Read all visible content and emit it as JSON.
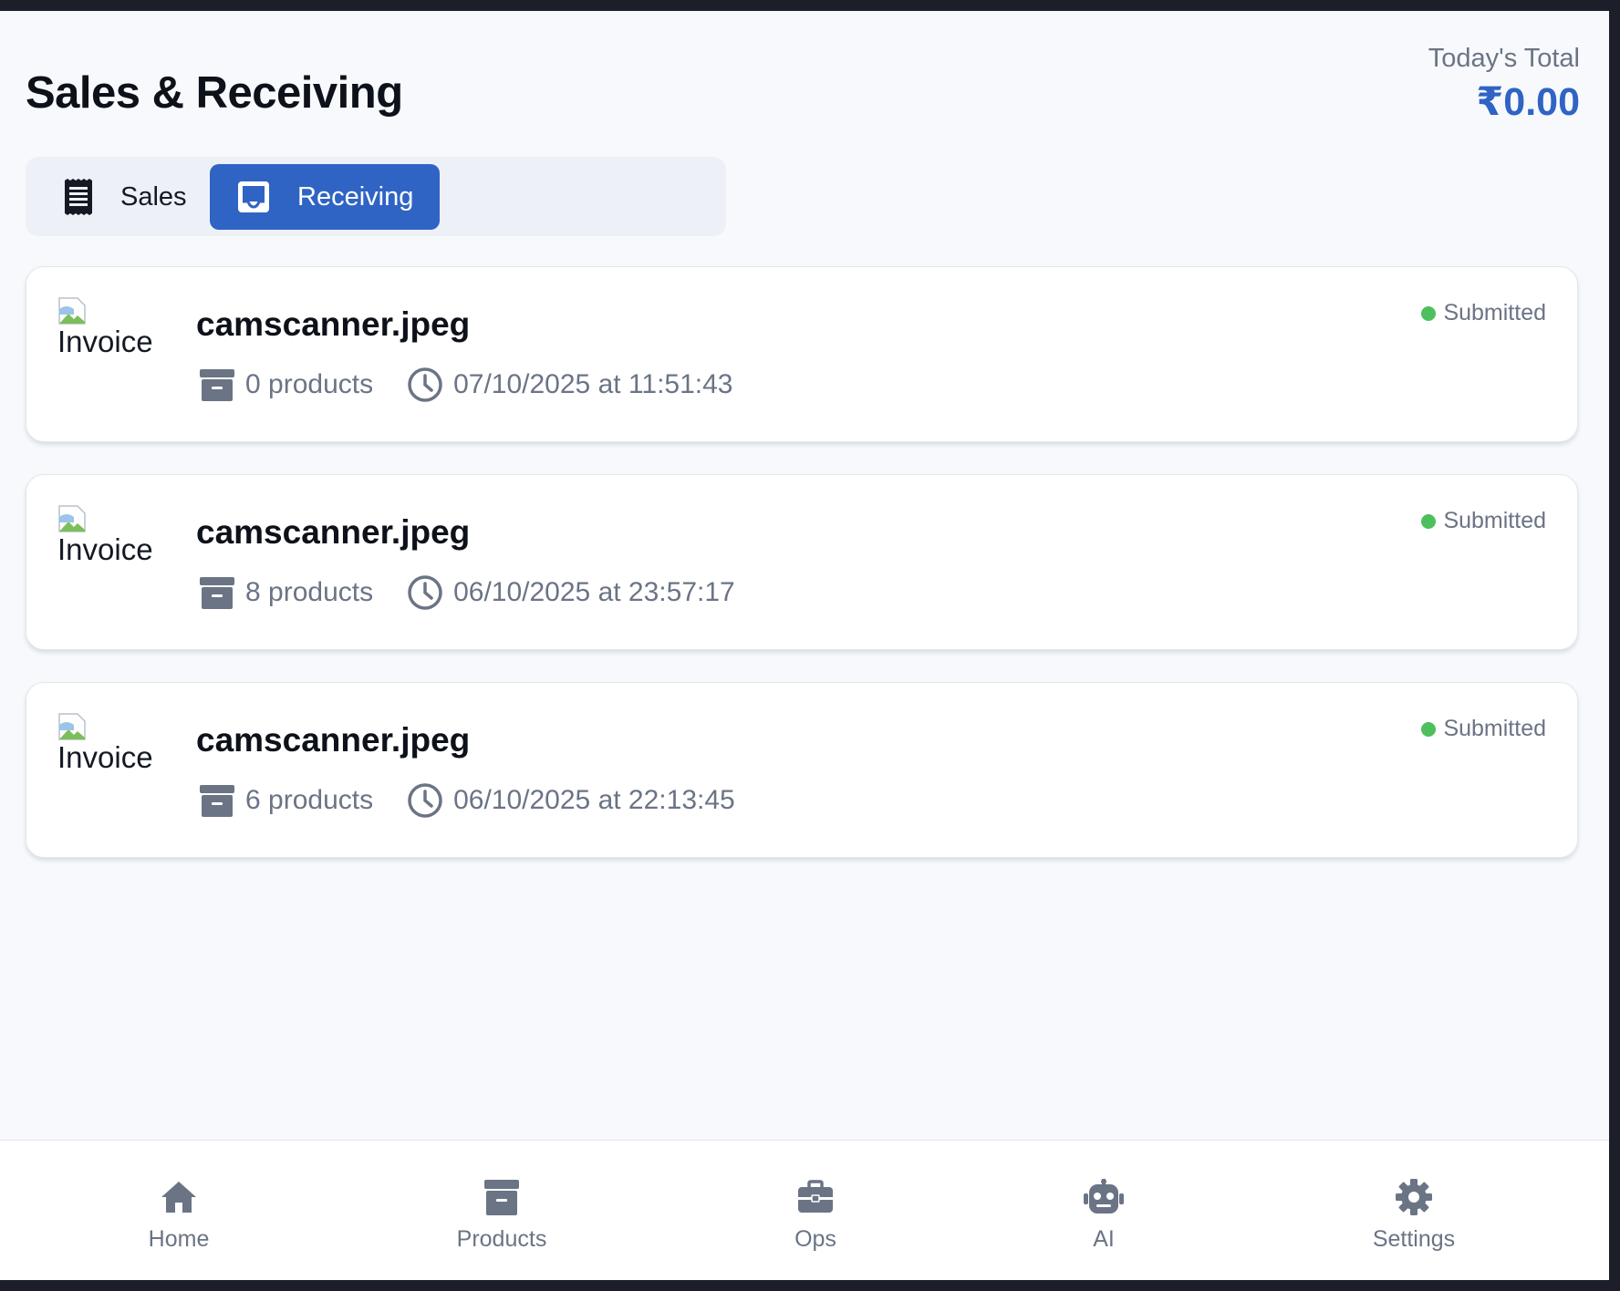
{
  "header": {
    "title": "Sales & Receiving",
    "total_label": "Today's Total",
    "total_value": "₹0.00"
  },
  "tabs": [
    {
      "label": "Sales",
      "icon": "receipt-icon",
      "active": false
    },
    {
      "label": "Receiving",
      "icon": "inbox-icon",
      "active": true
    }
  ],
  "receipts": [
    {
      "image_alt": "Invoice",
      "filename": "camscanner.jpeg",
      "products": "0 products",
      "datetime": "07/10/2025 at 11:51:43",
      "status": "Submitted"
    },
    {
      "image_alt": "Invoice",
      "filename": "camscanner.jpeg",
      "products": "8 products",
      "datetime": "06/10/2025 at 23:57:17",
      "status": "Submitted"
    },
    {
      "image_alt": "Invoice",
      "filename": "camscanner.jpeg",
      "products": "6 products",
      "datetime": "06/10/2025 at 22:13:45",
      "status": "Submitted"
    }
  ],
  "nav": [
    {
      "label": "Home",
      "icon": "home-icon"
    },
    {
      "label": "Products",
      "icon": "archive-icon"
    },
    {
      "label": "Ops",
      "icon": "briefcase-icon"
    },
    {
      "label": "AI",
      "icon": "robot-icon"
    },
    {
      "label": "Settings",
      "icon": "gear-icon"
    }
  ],
  "colors": {
    "accent": "#2f64c4",
    "status_submitted": "#4cc05d",
    "muted_text": "#6b7485",
    "background": "#f7f9fc"
  }
}
